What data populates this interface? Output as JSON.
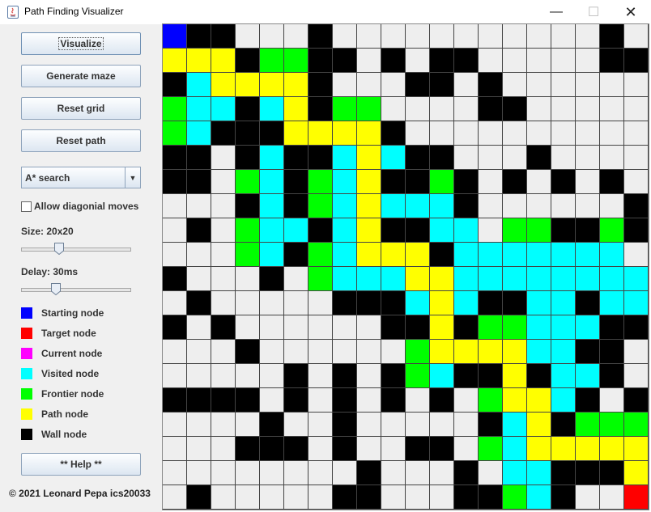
{
  "window": {
    "title": "Path Finding Visualizer",
    "controls": {
      "minimize": "—",
      "maximize": "☐",
      "close": "✕"
    }
  },
  "sidebar": {
    "buttons": {
      "visualize": "Visualize",
      "generate_maze": "Generate maze",
      "reset_grid": "Reset grid",
      "reset_path": "Reset path",
      "help": "** Help **"
    },
    "algorithm": {
      "selected": "A* search",
      "arrow": "▼"
    },
    "diagonal": {
      "label": "Allow diagonial moves",
      "checked": false
    },
    "size": {
      "label": "Size: 20x20",
      "value": 20,
      "min": 5,
      "max": 50
    },
    "delay": {
      "label": "Delay: 30ms",
      "value": 30,
      "min": 0,
      "max": 100
    },
    "legend": [
      {
        "label": "Starting node",
        "color": "#0000ff"
      },
      {
        "label": "Target node",
        "color": "#ff0000"
      },
      {
        "label": "Current node",
        "color": "#ff00ff"
      },
      {
        "label": "Visited node",
        "color": "#00ffff"
      },
      {
        "label": "Frontier node",
        "color": "#00ff00"
      },
      {
        "label": "Path node",
        "color": "#ffff00"
      },
      {
        "label": "Wall node",
        "color": "#000000"
      }
    ],
    "copyright": "© 2021 Leonard Pepa ics20033"
  },
  "grid": {
    "size": 20,
    "legend_codes": {
      "S": "start",
      "T": "target",
      "V": "visited",
      "F": "frontier",
      "P": "path",
      "W": "wall",
      "E": "empty"
    },
    "colors": {
      "S": "#0000ff",
      "T": "#ff0000",
      "V": "#00ffff",
      "F": "#00ff00",
      "P": "#ffff00",
      "W": "#000000",
      "E": "#eeeeee"
    },
    "rows": [
      "SWWEEEWEEEEEEEEEEEWE",
      "PPPWFFWWEWEWWEEEEEWW",
      "WVPPPPWEEEWWEWEEEEEE",
      "FVVWVPWFFEEEEWWEEEEE",
      "FVWWWPPPPWEEEEEEEEEE",
      "WWEWVWWVPVWWEEEWEEEE",
      "WWEFVWFVPWWFWEWEWEWE",
      "EEEWVWFVPVVVWEEEEEEW",
      "EWEFVVWVPWWVVEFFWWFW",
      "EEEFVWFVPPPWVVVVVVVE",
      "WEEEWEFVVVPPVVVVVVVV",
      "EWEEEEEWWWVPVWWVVWVV",
      "WEWEEEEEEWWPWFFVVVWW",
      "EEEWEEEEEEFPPPPVVWWE",
      "EEEEEWEWEWFVWWPWVVWE",
      "WWWWEWEWEWEWEFPPVWEW",
      "EEEEWEEWEEEEEWVPWFFF",
      "EEEWWWEWEEWWEFVPPPPP",
      "EEEEEEEEWEEEWEVVWWWP",
      "EWEEEEEWWEEEWWFVWEET"
    ]
  }
}
